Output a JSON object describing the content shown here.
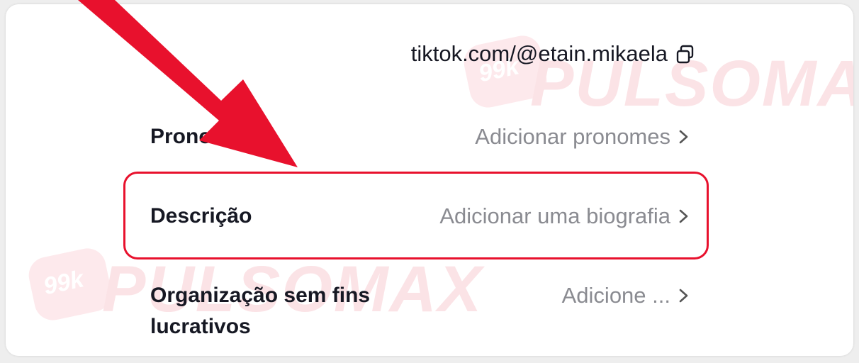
{
  "profile": {
    "link": "tiktok.com/@etain.mikaela"
  },
  "rows": [
    {
      "label": "Pronomes",
      "value": "Adicionar pronomes"
    },
    {
      "label": "Descrição",
      "value": "Adicionar uma biografia"
    },
    {
      "label_line1": "Organização sem fins",
      "label_line2": "lucrativos",
      "value": "Adicione ..."
    }
  ],
  "watermark": {
    "badge": "99k",
    "brand": "PULSOMAX"
  },
  "colors": {
    "accent": "#e8112d",
    "text": "#161823",
    "muted": "#8a8b91"
  },
  "icons": [
    "copy-icon",
    "chevron-right-icon",
    "arrow-pointer"
  ]
}
